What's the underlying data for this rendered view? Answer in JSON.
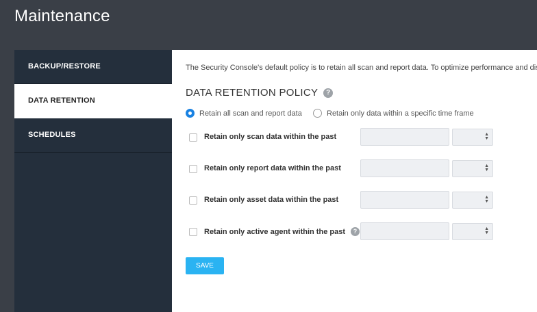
{
  "page_title": "Maintenance",
  "sidebar": {
    "items": [
      {
        "label": "BACKUP/RESTORE"
      },
      {
        "label": "DATA RETENTION"
      },
      {
        "label": "SCHEDULES"
      }
    ],
    "active": "DATA RETENTION"
  },
  "main": {
    "intro": "The Security Console's default policy is to retain all scan and report data. To optimize performance and disk space, you can change the policy to retain only data within a specific time frame.",
    "section_title": "DATA RETENTION POLICY",
    "help_icon": "question-circle-icon",
    "radios": [
      {
        "label": "Retain all scan and report data",
        "checked": true
      },
      {
        "label": "Retain only data within a specific time frame",
        "checked": false
      }
    ],
    "options": [
      {
        "label": "Retain only scan data within the past",
        "value": "",
        "unit": ""
      },
      {
        "label": "Retain only report data within the past",
        "value": "",
        "unit": ""
      },
      {
        "label": "Retain only asset data within the past",
        "value": "",
        "unit": ""
      },
      {
        "label": "Retain only active agent within the past",
        "value": "",
        "unit": "",
        "has_help": true
      }
    ],
    "save_label": "SAVE"
  },
  "colors": {
    "background": "#3a3f47",
    "sidebar": "#242f3c",
    "accent": "#2ab3f2",
    "radio_checked": "#1a82e2"
  }
}
